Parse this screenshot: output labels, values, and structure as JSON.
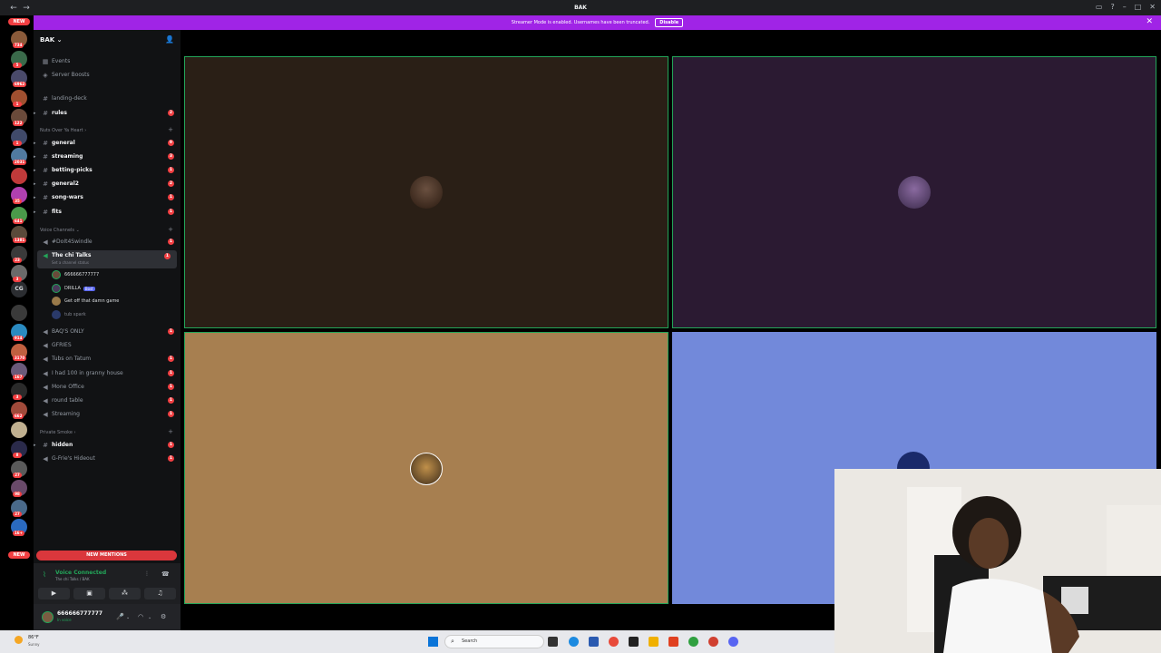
{
  "window": {
    "title": "BAK"
  },
  "banner": {
    "text": "Streamer Mode is enabled. Usernames have been truncated.",
    "button": "Disable"
  },
  "server_rail": {
    "new_label_top": "NEW",
    "new_label_bottom": "NEW",
    "servers": [
      {
        "badge": "734",
        "color": "#8a5a3a"
      },
      {
        "badge": "5",
        "color": "#3a6a4a"
      },
      {
        "badge": "6962",
        "color": "#4a4a6a"
      },
      {
        "badge": "1",
        "color": "#a05030"
      },
      {
        "badge": "122",
        "color": "#6a4a3a"
      },
      {
        "badge": "1",
        "color": "#404a6a"
      },
      {
        "badge": "2031",
        "color": "#507aa0"
      },
      {
        "badge": "",
        "color": "#c03a3a"
      },
      {
        "badge": "35",
        "color": "#b040b0"
      },
      {
        "badge": "641",
        "color": "#4a9a4a"
      },
      {
        "badge": "1381",
        "color": "#5a4a3a"
      },
      {
        "badge": "23",
        "color": "#3a3a3a"
      },
      {
        "badge": "3",
        "color": "#6a6a6a"
      },
      {
        "badge": "",
        "color": "#3a3a3a"
      },
      {
        "badge": "914",
        "color": "#2a8ac0"
      },
      {
        "badge": "3170",
        "color": "#c06040"
      },
      {
        "badge": "167",
        "color": "#6a5a7a"
      },
      {
        "badge": "3",
        "color": "#2a2a2a"
      },
      {
        "badge": "662",
        "color": "#a04a3a"
      },
      {
        "badge": "",
        "color": "#c0b090"
      },
      {
        "badge": "8",
        "color": "#2a2a4a"
      },
      {
        "badge": "27",
        "color": "#5a5a5a"
      },
      {
        "badge": "98",
        "color": "#6a4a6a"
      },
      {
        "badge": "27",
        "color": "#4a6a8a"
      },
      {
        "badge": "16+",
        "color": "#2a6ac0"
      }
    ],
    "text_server": "CG"
  },
  "sidebar": {
    "server_name": "BAK",
    "items": {
      "events": "Events",
      "server_boosts": "Server Boosts",
      "landing_deck": "landing-deck",
      "rules": "rules",
      "rules_count": "2",
      "cat1": "Nuts Over Ya Heart",
      "general": "general",
      "general_count": "9",
      "streaming": "streaming",
      "streaming_count": "3",
      "betting_picks": "betting-picks",
      "betting_picks_count": "1",
      "general2": "general2",
      "general2_count": "2",
      "song_wars": "song-wars",
      "song_wars_count": "1",
      "fits": "fits",
      "fits_count": "1",
      "cat_voice": "Voice Channels",
      "doit": "#DoIt4Swindle",
      "doit_count": "1",
      "chi_talks": "The chi Talks",
      "chi_talks_count": "1",
      "chi_talks_sub": "Set a channel status",
      "user1": "666666777777",
      "user2": "DRILLA",
      "user2_tag": "Bost",
      "user3": "Get off that damn game",
      "user4": "tub spark",
      "baqs_only": "BAQ'S ONLY",
      "baqs_only_count": "1",
      "gfries": "GFRIES",
      "tubs": "Tubs on Tatum",
      "tubs_count": "1",
      "granny": "I had 100 in granny house",
      "granny_count": "1",
      "mone": "Mone Office",
      "mone_count": "1",
      "round_table": "round table",
      "round_table_count": "1",
      "streaming_voice": "Streaming",
      "streaming_voice_count": "1",
      "cat_private": "Private Smoke",
      "hidden": "hidden",
      "hidden_count": "1",
      "hideout": "G-Frie's Hideout",
      "hideout_count": "1"
    },
    "new_mentions": "NEW MENTIONS"
  },
  "voice_panel": {
    "status": "Voice Connected",
    "location": "The chi Talks / BAK"
  },
  "user_panel": {
    "username": "666666777777",
    "status": "In voice"
  },
  "taskbar": {
    "weather_temp": "86°F",
    "weather_desc": "Sunny",
    "search_placeholder": "Search"
  },
  "colors": {
    "tile1": "#2a1f16",
    "tile2": "#2b1a32",
    "tile3": "#a77f50",
    "tile4": "#7289da",
    "speaking": "#23a559",
    "banner": "#a024e6",
    "mention": "#f23f42"
  }
}
